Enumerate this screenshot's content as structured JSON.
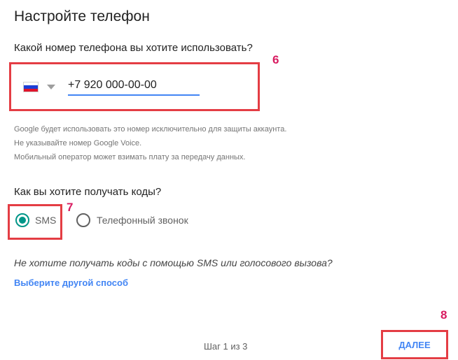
{
  "page": {
    "title": "Настройте телефон"
  },
  "phone": {
    "question": "Какой номер телефона вы хотите использовать?",
    "country_icon": "russia-flag-icon",
    "number_value": "+7 920 000-00-00",
    "notes": [
      "Google будет использовать это номер исключительно для защиты аккаунта.",
      "Не указывайте номер Google Voice.",
      "Мобильный оператор может взимать плату за передачу данных."
    ]
  },
  "codes": {
    "question": "Как вы хотите получать коды?",
    "options": [
      {
        "label": "SMS",
        "selected": true
      },
      {
        "label": "Телефонный звонок",
        "selected": false
      }
    ],
    "alt_question": "Не хотите получать коды с помощью SMS или голосового вызова?",
    "alt_link": "Выберите другой способ"
  },
  "footer": {
    "step": "Шаг 1 из 3",
    "next_label": "ДАЛЕЕ"
  },
  "annotations": {
    "badge_6": "6",
    "badge_7": "7",
    "badge_8": "8"
  },
  "colors": {
    "accent_blue": "#4285f4",
    "radio_teal": "#009688",
    "annotation_red": "#e43d44",
    "badge_pink": "#d81b60"
  }
}
